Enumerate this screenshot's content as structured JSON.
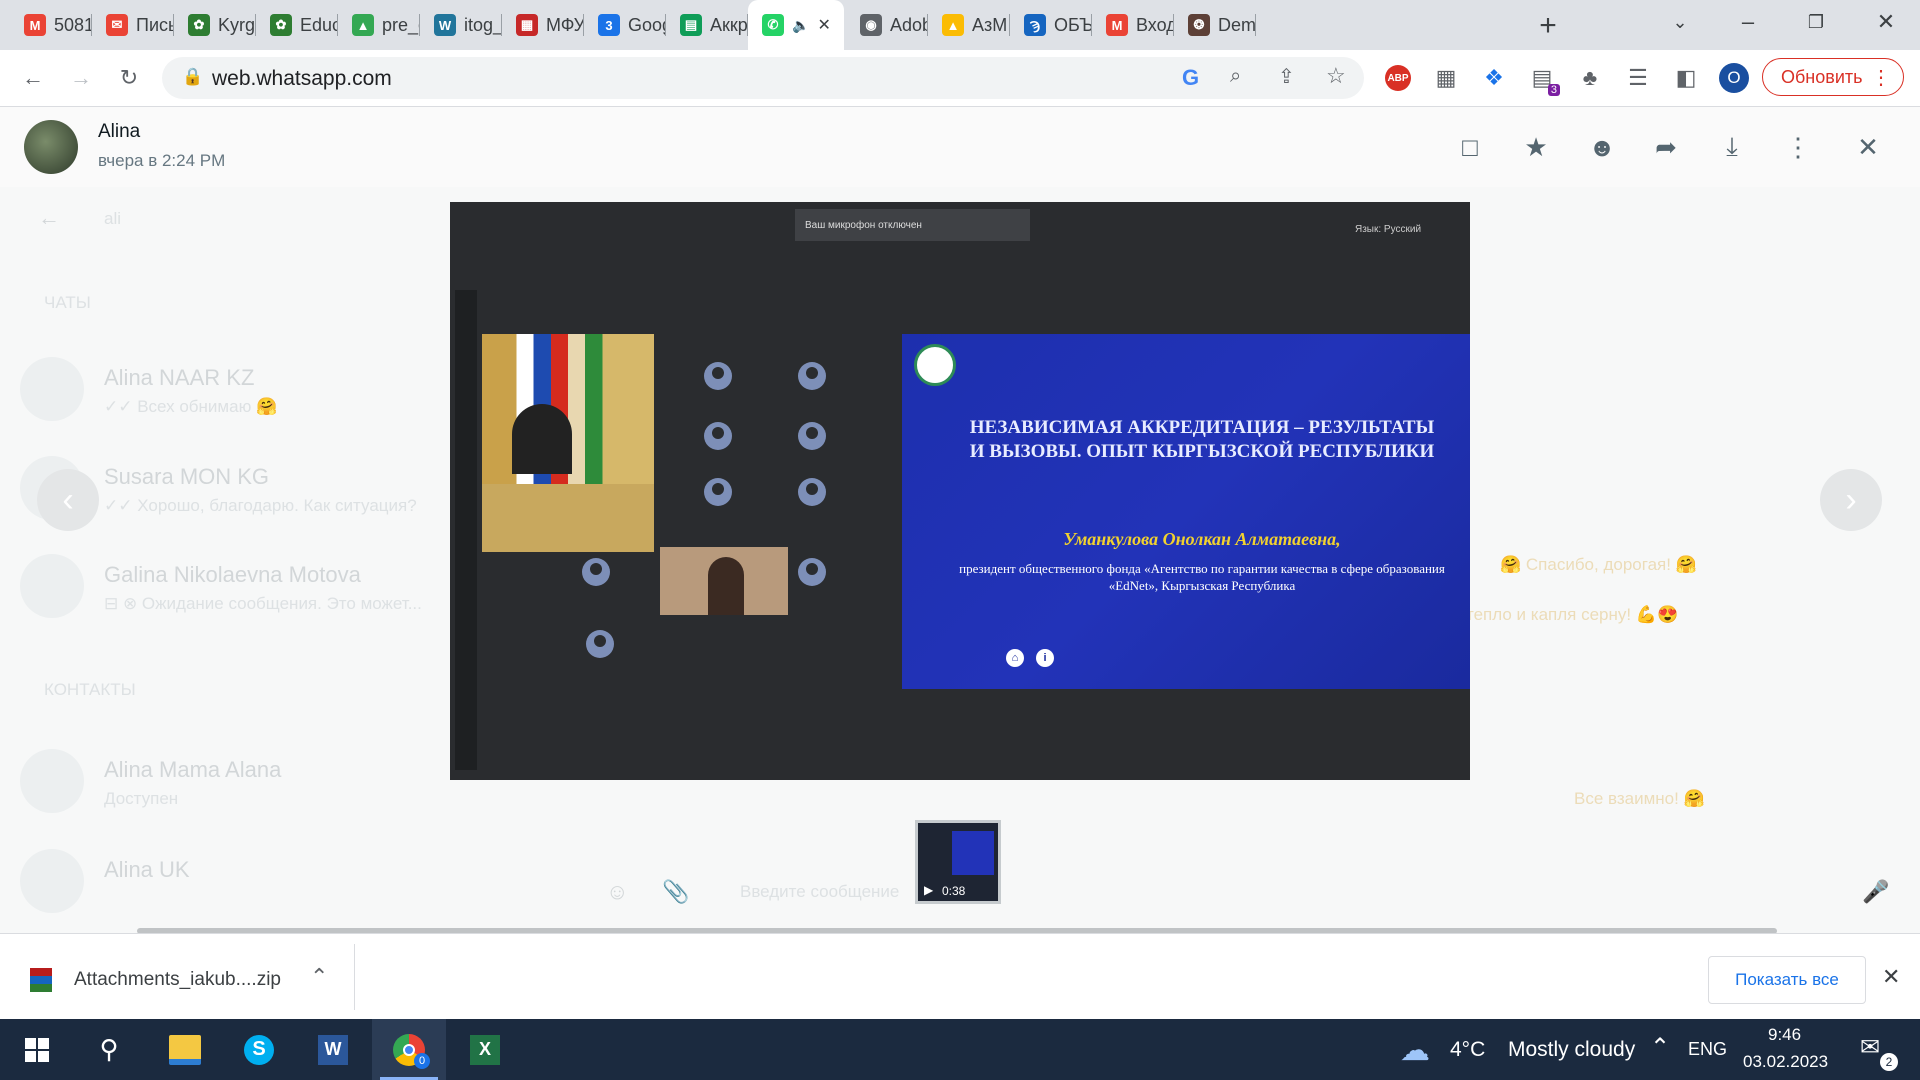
{
  "tabs": [
    {
      "label": "5081",
      "icon": "gmail-icon",
      "color": "#ea4335"
    },
    {
      "label": "Пись",
      "icon": "mail-icon",
      "color": "#ea4335"
    },
    {
      "label": "Kyrgy",
      "icon": "flower-icon",
      "color": "#2e7d32"
    },
    {
      "label": "Educ",
      "icon": "flower-icon",
      "color": "#2e7d32"
    },
    {
      "label": "pre_c",
      "icon": "drive-icon",
      "color": "#34a853"
    },
    {
      "label": "itog_",
      "icon": "wordpress-icon",
      "color": "#21759b"
    },
    {
      "label": "МФУ",
      "icon": "printer-icon",
      "color": "#c62828"
    },
    {
      "label": "Goog",
      "icon": "calendar-icon",
      "color": "#1a73e8"
    },
    {
      "label": "Аккр",
      "icon": "sheets-icon",
      "color": "#0f9d58"
    },
    {
      "label": "",
      "icon": "whatsapp-icon",
      "color": "#25d366",
      "active": true
    },
    {
      "label": "Adob",
      "icon": "globe-icon",
      "color": "#5f6368"
    },
    {
      "label": "АзМ",
      "icon": "drive-icon",
      "color": "#fbbc04"
    },
    {
      "label": "ОБЪ",
      "icon": "site-icon",
      "color": "#1565c0"
    },
    {
      "label": "Вход",
      "icon": "gmail-icon",
      "color": "#ea4335"
    },
    {
      "label": "Dem",
      "icon": "seal-icon",
      "color": "#5d4037"
    }
  ],
  "toolbar": {
    "url": "web.whatsapp.com",
    "update_label": "Обновить",
    "profile_initial": "O",
    "extension_badge": "3",
    "abp_label": "ABP"
  },
  "viewer": {
    "sender_name": "Alina",
    "sender_time": "вчера в 2:24 PM",
    "video_duration": "0:38"
  },
  "video": {
    "mic_notice": "Ваш микрофон отключен",
    "language": "Язык: Русский",
    "slide_title": "НЕЗАВИСИМАЯ АККРЕДИТАЦИЯ – РЕЗУЛЬТАТЫ И ВЫЗОВЫ. ОПЫТ КЫРГЫЗСКОЙ РЕСПУБЛИКИ",
    "slide_author": "Уманкулова Онолкан Алматаевна,",
    "slide_role": "президент общественного фонда «Агентство по гарантии качества в сфере образования «EdNet», Кыргызская Республика"
  },
  "background_chat": {
    "search_text": "ali",
    "chats_header": "ЧАТЫ",
    "contacts_header": "КОНТАКТЫ",
    "items": [
      {
        "name": "Alina NAAR KZ",
        "preview": "✓✓ Всех обнимаю 🤗"
      },
      {
        "name": "Susara MON KG",
        "preview": "✓✓ Хорошо, благодарю. Как ситуация?"
      },
      {
        "name": "Galina Nikolaevna Motova",
        "preview": "⊟ ⊗ Ожидание сообщения. Это может..."
      },
      {
        "name": "Alina Mama Alana",
        "preview": "Доступен"
      },
      {
        "name": "Alina UK",
        "preview": ""
      }
    ],
    "messages": [
      "🤗 Спасибо, дорогая! 🤗",
      "тепло и капля серну! 💪😍",
      "Все взаимно! 🤗"
    ],
    "input_placeholder": "Введите сообщение"
  },
  "downloads": {
    "filename": "Attachments_iakub....zip",
    "show_all": "Показать все"
  },
  "taskbar": {
    "weather_temp": "4°C",
    "weather_text": "Mostly cloudy",
    "lang": "ENG",
    "time": "9:46",
    "date": "03.02.2023",
    "notification_count": "2",
    "chrome_badge": "0"
  }
}
